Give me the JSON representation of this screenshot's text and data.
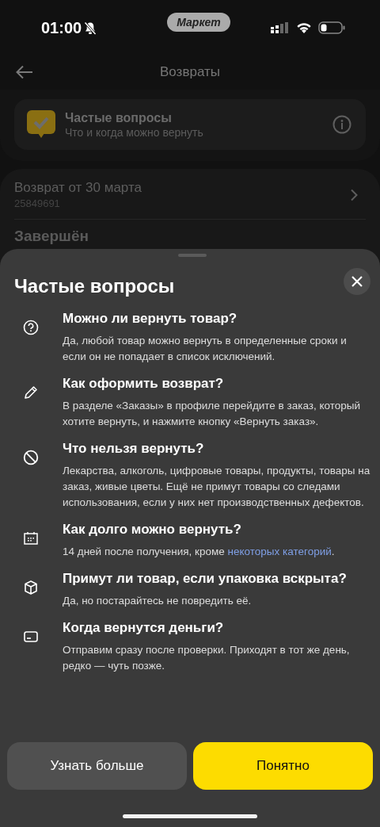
{
  "status_bar": {
    "time": "01:00",
    "app_pill": "Маркет",
    "muted": true
  },
  "header": {
    "title": "Возвраты"
  },
  "faq_card": {
    "title": "Частые вопросы",
    "subtitle": "Что и когда можно вернуть"
  },
  "return_row": {
    "title": "Возврат от 30 марта",
    "number": "25849691"
  },
  "section_title": "Завершён",
  "sheet": {
    "title": "Частые вопросы",
    "items": [
      {
        "kind": "question",
        "title": "Можно ли вернуть товар?",
        "body": [
          {
            "kind": "text",
            "text": "Да, любой товар можно вернуть в определенные сроки и если он не попадает в список исключений."
          }
        ]
      },
      {
        "kind": "pencil",
        "title": "Как оформить возврат?",
        "body": [
          {
            "kind": "text",
            "text": "В разделе «Заказы» в профиле перейдите в заказ, который хотите вернуть, и нажмите кнопку «Вернуть заказ»."
          }
        ]
      },
      {
        "kind": "forbidden",
        "title": "Что нельзя вернуть?",
        "body": [
          {
            "kind": "text",
            "text": "Лекарства, алкоголь, цифровые товары, продукты, товары на заказ, живые цветы. Ещё не примут товары со следами использования, если у них нет производственных дефектов."
          }
        ]
      },
      {
        "kind": "calendar",
        "title": "Как долго можно вернуть?",
        "body": [
          {
            "kind": "text",
            "text": "14 дней после получения, кроме "
          },
          {
            "kind": "link",
            "text": "некоторых категорий"
          },
          {
            "kind": "text",
            "text": "."
          }
        ]
      },
      {
        "kind": "box",
        "title": "Примут ли товар, если упаковка вскрыта?",
        "body": [
          {
            "kind": "text",
            "text": "Да, но постарайтесь не повредить её."
          }
        ]
      },
      {
        "kind": "card",
        "title": "Когда вернутся деньги?",
        "body": [
          {
            "kind": "text",
            "text": "Отправим сразу после проверки. Приходят в тот же день, редко — чуть позже."
          }
        ]
      }
    ],
    "buttons": [
      {
        "kind": "secondary",
        "label": "Узнать больше"
      },
      {
        "kind": "primary",
        "label": "Понятно"
      }
    ]
  }
}
